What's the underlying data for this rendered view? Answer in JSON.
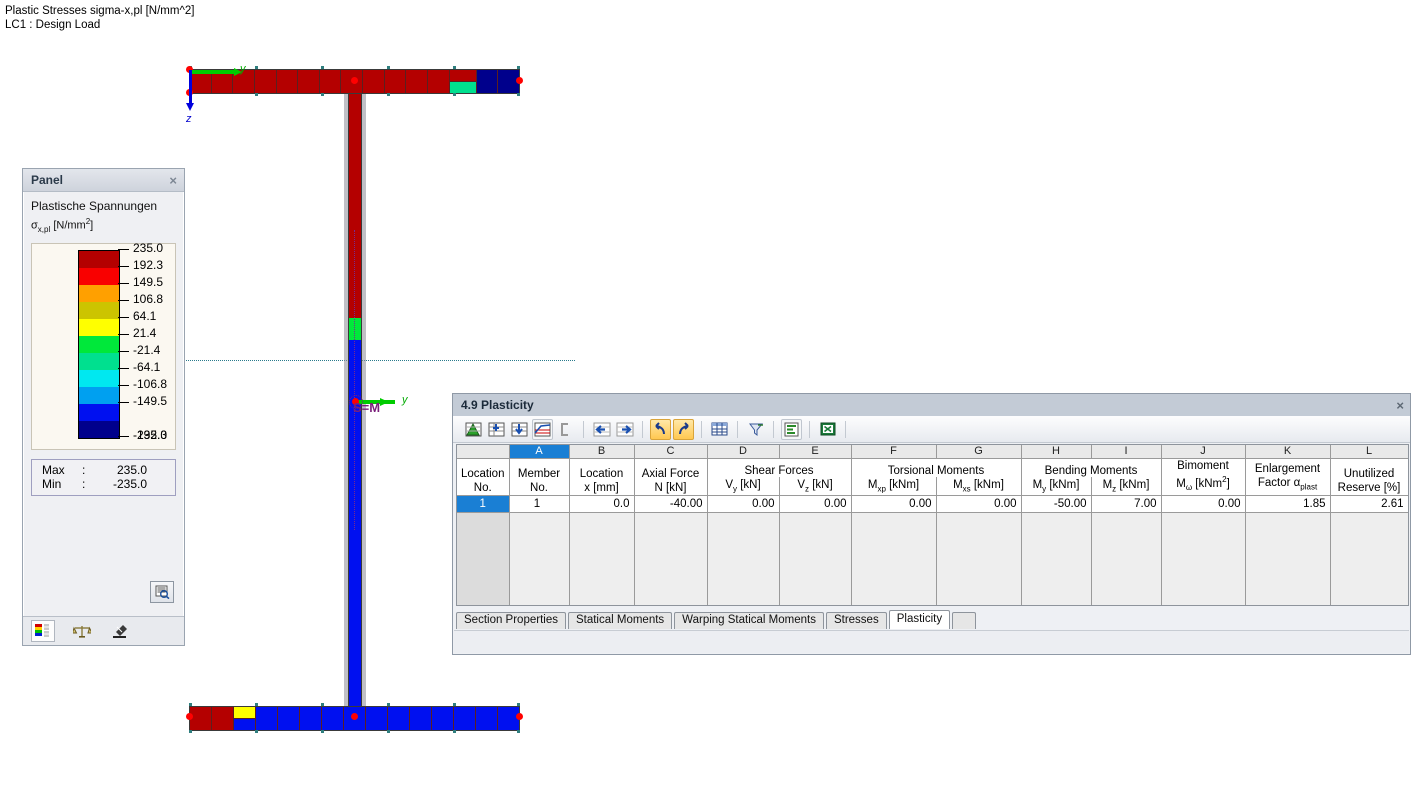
{
  "caption": {
    "line1": "Plastic Stresses sigma-x,pl [N/mm^2]",
    "line2": "LC1 : Design Load"
  },
  "model": {
    "axis_y_label": "y",
    "axis_z_label": "z",
    "centroid_label": "S=M"
  },
  "panel": {
    "title": "Panel",
    "close_icon": "×",
    "legend_title": "Plastische Spannungen",
    "legend_symbol_main": "σ",
    "legend_symbol_sub": "x,pl",
    "legend_unit": "[N/mm",
    "legend_unit_sup": "2",
    "legend_unit_close": "]",
    "ticks": [
      "235.0",
      "192.3",
      "149.5",
      "106.8",
      "64.1",
      "21.4",
      "-21.4",
      "-64.1",
      "-106.8",
      "-149.5",
      "-192.3",
      "-235.0"
    ],
    "colors": [
      "#b40000",
      "#f90000",
      "#ffa000",
      "#ccc400",
      "#ffff00",
      "#00e83a",
      "#00e08f",
      "#00e8f0",
      "#00a0f0",
      "#0010f0",
      "#00008c"
    ],
    "max_label": "Max",
    "max_colon": ":",
    "max_value": "235.0",
    "min_label": "Min",
    "min_colon": ":",
    "min_value": "-235.0",
    "tabs": [
      "colors-legend-icon",
      "scales-icon",
      "microscope-icon"
    ],
    "magnify_icon": "magnifier-icon"
  },
  "table_window": {
    "title": "4.9 Plasticity",
    "close_icon": "×",
    "toolbar": [
      {
        "name": "show-graphic-icon",
        "state": "normal"
      },
      {
        "name": "insert-row-icon",
        "state": "normal"
      },
      {
        "name": "delete-row-icon",
        "state": "normal"
      },
      {
        "name": "results-diagram-icon",
        "state": "framed"
      },
      {
        "name": "selection-bracket-icon",
        "state": "normal"
      },
      {
        "name": "previous-icon",
        "state": "normal"
      },
      {
        "name": "next-icon",
        "state": "normal"
      },
      {
        "name": "undo-icon",
        "state": "on"
      },
      {
        "name": "redo-icon",
        "state": "on"
      },
      {
        "name": "grid-table-icon",
        "state": "normal"
      },
      {
        "name": "filter-icon",
        "state": "normal"
      },
      {
        "name": "report-icon",
        "state": "framed"
      },
      {
        "name": "export-excel-icon",
        "state": "normal"
      }
    ],
    "column_letters": [
      "",
      "A",
      "B",
      "C",
      "D",
      "E",
      "F",
      "G",
      "H",
      "I",
      "J",
      "K",
      "L"
    ],
    "selected_column_letter": "A",
    "groups": [
      {
        "label": "",
        "span": 1
      },
      {
        "label": "",
        "span": 1
      },
      {
        "label": "",
        "span": 1
      },
      {
        "label": "",
        "span": 1
      },
      {
        "label": "Shear Forces",
        "span": 2
      },
      {
        "label": "Torsional Moments",
        "span": 2
      },
      {
        "label": "Bending Moments",
        "span": 2
      },
      {
        "label": "",
        "span": 1
      },
      {
        "label": "",
        "span": 1
      },
      {
        "label": "",
        "span": 1
      }
    ],
    "headers": [
      {
        "l1": "Location",
        "l2": "No."
      },
      {
        "l1": "Member",
        "l2": "No."
      },
      {
        "l1": "Location",
        "l2": "x [mm]"
      },
      {
        "l1": "Axial Force",
        "l2": "N [kN]"
      },
      {
        "l1": "",
        "l2": "V_y [kN]"
      },
      {
        "l1": "",
        "l2": "V_z [kN]"
      },
      {
        "l1": "",
        "l2": "M_xp [kNm]"
      },
      {
        "l1": "",
        "l2": "M_xs [kNm]"
      },
      {
        "l1": "",
        "l2": "M_y [kNm]"
      },
      {
        "l1": "",
        "l2": "M_z [kNm]"
      },
      {
        "l1": "Bimoment",
        "l2": "M_w [kNm2]"
      },
      {
        "l1": "Enlargement",
        "l2": "Factor a_plast"
      },
      {
        "l1": "Unutilized",
        "l2": "Reserve [%]"
      }
    ],
    "rows": [
      [
        "1",
        "1",
        "0.0",
        "-40.00",
        "0.00",
        "0.00",
        "0.00",
        "0.00",
        "-50.00",
        "7.00",
        "0.00",
        "1.85",
        "2.61"
      ]
    ],
    "tabs": [
      {
        "label": "Section Properties",
        "selected": false
      },
      {
        "label": "Statical Moments",
        "selected": false
      },
      {
        "label": "Warping Statical Moments",
        "selected": false
      },
      {
        "label": "Stresses",
        "selected": false
      },
      {
        "label": "Plasticity",
        "selected": true
      }
    ]
  },
  "chart_data": {
    "type": "heatmap",
    "title": "Plastic Stresses sigma-x,pl [N/mm^2]",
    "subtitle": "LC1 : Design Load",
    "colorbar_label": "Plastische Spannungen  sigma_x,pl [N/mm^2]",
    "colorbar_ticks": [
      235.0,
      192.3,
      149.5,
      106.8,
      64.1,
      21.4,
      -21.4,
      -64.1,
      -106.8,
      -149.5,
      -192.3,
      -235.0
    ],
    "colorbar_colors": [
      "#b40000",
      "#f90000",
      "#ffa000",
      "#ccc400",
      "#ffff00",
      "#00e83a",
      "#00e08f",
      "#00e8f0",
      "#00a0f0",
      "#0010f0",
      "#00008c"
    ],
    "max": 235.0,
    "min": -235.0,
    "legend_position": "left-panel",
    "regions": [
      {
        "name": "top-flange-main",
        "color": "#b40000",
        "value": 235.0
      },
      {
        "name": "top-flange-right-tip",
        "color": "#00008c",
        "value": -235.0
      },
      {
        "name": "top-flange-transition",
        "color": "#00e08f",
        "value": -45.0
      },
      {
        "name": "web-upper",
        "color": "#b40000",
        "value": 235.0
      },
      {
        "name": "web-transition",
        "color": "#00e83a",
        "value": 0.0
      },
      {
        "name": "web-lower",
        "color": "#0010f0",
        "value": -235.0
      },
      {
        "name": "bottom-flange-main",
        "color": "#0010f0",
        "value": -235.0
      },
      {
        "name": "bottom-flange-left-tip",
        "color": "#b40000",
        "value": 235.0
      },
      {
        "name": "bottom-flange-transition",
        "color": "#ffff00",
        "value": 64.1
      }
    ]
  }
}
